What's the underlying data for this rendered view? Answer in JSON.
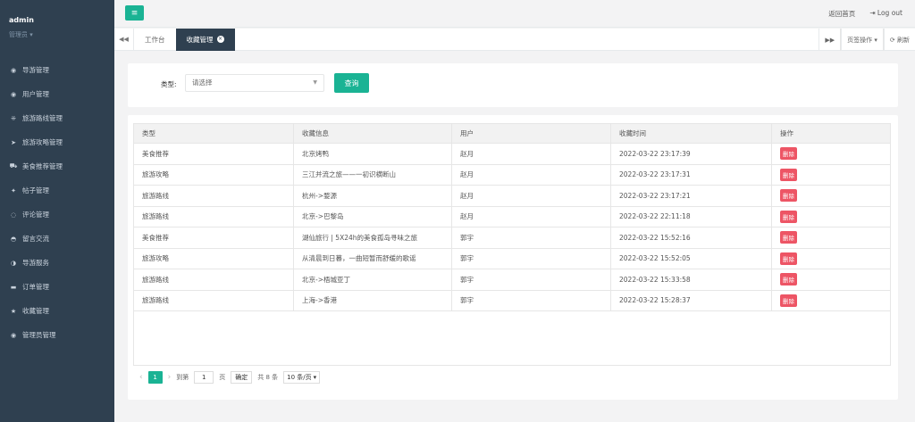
{
  "user": {
    "name": "admin",
    "role": "管理员 ▾"
  },
  "sidebar": {
    "items": [
      {
        "label": "导游管理",
        "icon": "user-circle-icon",
        "glyph": "◉"
      },
      {
        "label": "用户管理",
        "icon": "user-circle-icon",
        "glyph": "◉"
      },
      {
        "label": "旅游路线管理",
        "icon": "route-icon",
        "glyph": "⁜"
      },
      {
        "label": "旅游攻略管理",
        "icon": "paper-plane-icon",
        "glyph": "➤"
      },
      {
        "label": "美食推荐管理",
        "icon": "car-icon",
        "glyph": "⛟"
      },
      {
        "label": "帖子管理",
        "icon": "flash-icon",
        "glyph": "✦"
      },
      {
        "label": "评论管理",
        "icon": "comment-icon",
        "glyph": "◌"
      },
      {
        "label": "留言交流",
        "icon": "chat-icon",
        "glyph": "◓"
      },
      {
        "label": "导游服务",
        "icon": "service-icon",
        "glyph": "◑"
      },
      {
        "label": "订单管理",
        "icon": "credit-card-icon",
        "glyph": "▬"
      },
      {
        "label": "收藏管理",
        "icon": "star-icon",
        "glyph": "★"
      },
      {
        "label": "管理员管理",
        "icon": "admin-icon",
        "glyph": "◉"
      }
    ]
  },
  "topbar": {
    "menu_glyph": "≡",
    "home_link": "返回首页",
    "logout_icon": "⇥",
    "logout": "Log out"
  },
  "tabs": {
    "prev": "◀◀",
    "items": [
      {
        "label": "工作台"
      },
      {
        "label": "收藏管理"
      }
    ],
    "close_glyph": "×",
    "next": "▶▶",
    "page_ops": "页签操作 ▾",
    "refresh": "⟳ 刷新"
  },
  "search": {
    "type_label": "类型:",
    "type_placeholder": "请选择",
    "caret": "▼",
    "query_button": "查询"
  },
  "table": {
    "columns": [
      "类型",
      "收藏信息",
      "用户",
      "收藏时间",
      "操作"
    ],
    "delete_label": "删除",
    "rows": [
      [
        "美食推荐",
        "北京烤鸭",
        "赵月",
        "2022-03-22 23:17:39"
      ],
      [
        "旅游攻略",
        "三江并流之旅——一初识横断山",
        "赵月",
        "2022-03-22 23:17:31"
      ],
      [
        "旅游路线",
        "杭州->婺源",
        "赵月",
        "2022-03-22 23:17:21"
      ],
      [
        "旅游路线",
        "北京->巴黎岛",
        "赵月",
        "2022-03-22 22:11:18"
      ],
      [
        "美食推荐",
        "湖仙旅行 | 5X24h的美食孤岛寻味之旅",
        "郭宇",
        "2022-03-22 15:52:16"
      ],
      [
        "旅游攻略",
        "从清晨到日暮，一曲短暂而舒缓的歌谣",
        "郭宇",
        "2022-03-22 15:52:05"
      ],
      [
        "旅游路线",
        "北京->梧城亚丁",
        "郭宇",
        "2022-03-22 15:33:58"
      ],
      [
        "旅游路线",
        "上海->香港",
        "郭宇",
        "2022-03-22 15:28:37"
      ]
    ]
  },
  "pager": {
    "prev": "‹",
    "page": "1",
    "next": "›",
    "goto_prefix": "到第",
    "goto_value": "1",
    "goto_suffix": "页",
    "confirm": "确定",
    "total": "共 8 条",
    "page_size": "10 条/页",
    "size_caret": "▾"
  }
}
